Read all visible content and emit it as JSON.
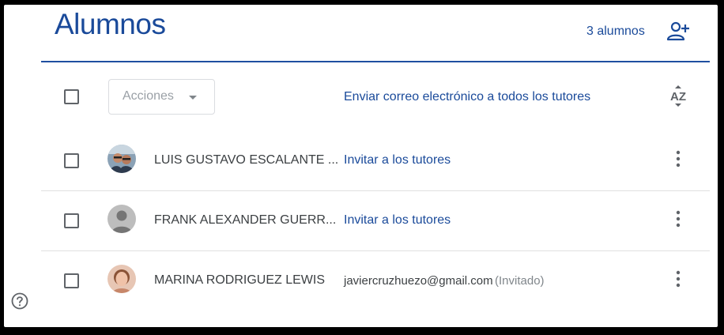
{
  "page": {
    "title": "Alumnos",
    "student_count": "3 alumnos"
  },
  "icons": {
    "add_student": "person-add-icon",
    "sort": "sort-az-icon",
    "more": "more-vert-icon",
    "help": "help-circle-icon",
    "dropdown": "caret-down-icon"
  },
  "toolbar": {
    "actions_label": "Acciones",
    "email_all_guardians": "Enviar correo electrónico a todos los tutores",
    "sort_glyph": "AZ"
  },
  "students": [
    {
      "name": "LUIS GUSTAVO ESCALANTE ...",
      "avatar": "photo",
      "guardian_action": "Invitar a los tutores"
    },
    {
      "name": "FRANK ALEXANDER GUERR...",
      "avatar": "default",
      "guardian_action": "Invitar a los tutores"
    },
    {
      "name": "MARINA RODRIGUEZ LEWIS",
      "avatar": "photo",
      "guardian_email": "javiercruzhuezo@gmail.com",
      "guardian_status": "(Invitado)"
    }
  ],
  "colors": {
    "accent_blue": "#1a4a9a",
    "divider_blue": "#1f4fa0",
    "text_dark": "#3c4043",
    "text_muted": "#80868b"
  }
}
